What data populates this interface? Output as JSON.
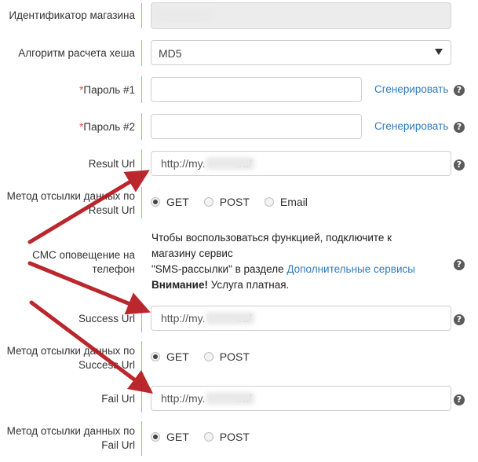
{
  "fields": {
    "shop_id": {
      "label": "Идентификатор магазина",
      "value": ""
    },
    "hash_algo": {
      "label": "Алгоритм расчета хеша",
      "value": "MD5"
    },
    "password1": {
      "required_mark": "*",
      "label": "Пароль #1",
      "value": "",
      "generate_link": "Сгенерировать"
    },
    "password2": {
      "required_mark": "*",
      "label": "Пароль #2",
      "value": "",
      "generate_link": "Сгенерировать"
    },
    "result_url": {
      "label": "Result Url",
      "value": "http://my.          .ru/"
    },
    "result_method": {
      "label_line1": "Метод отсылки данных по",
      "label_line2": "Result Url",
      "options": [
        "GET",
        "POST",
        "Email"
      ],
      "selected": "GET"
    },
    "sms": {
      "label_line1": "СМС оповещение на",
      "label_line2": "телефон",
      "text_line1": "Чтобы воспользоваться функцией, подключите к",
      "text_line2": "магазину сервис",
      "text_line3_a": "\"SMS-рассылки\" в разделе ",
      "text_line3_link": "Дополнительные сервисы",
      "text_line4_bold": "Внимание!",
      "text_line4_rest": " Услуга платная."
    },
    "success_url": {
      "label": "Success Url",
      "value": "http://my.          .ru/"
    },
    "success_method": {
      "label_line1": "Метод отсылки данных по",
      "label_line2": "Success Url",
      "options": [
        "GET",
        "POST"
      ],
      "selected": "GET"
    },
    "fail_url": {
      "label": "Fail Url",
      "value": "http://my.          .ru/"
    },
    "fail_method": {
      "label_line1": "Метод отсылки данных по",
      "label_line2": "Fail Url",
      "options": [
        "GET",
        "POST"
      ],
      "selected": "GET"
    }
  },
  "help_icon_glyph": "?",
  "colors": {
    "link": "#2f7bbf",
    "separator": "#7fc1ce",
    "required": "#d9534f",
    "annotation_arrow": "#b5151b"
  }
}
